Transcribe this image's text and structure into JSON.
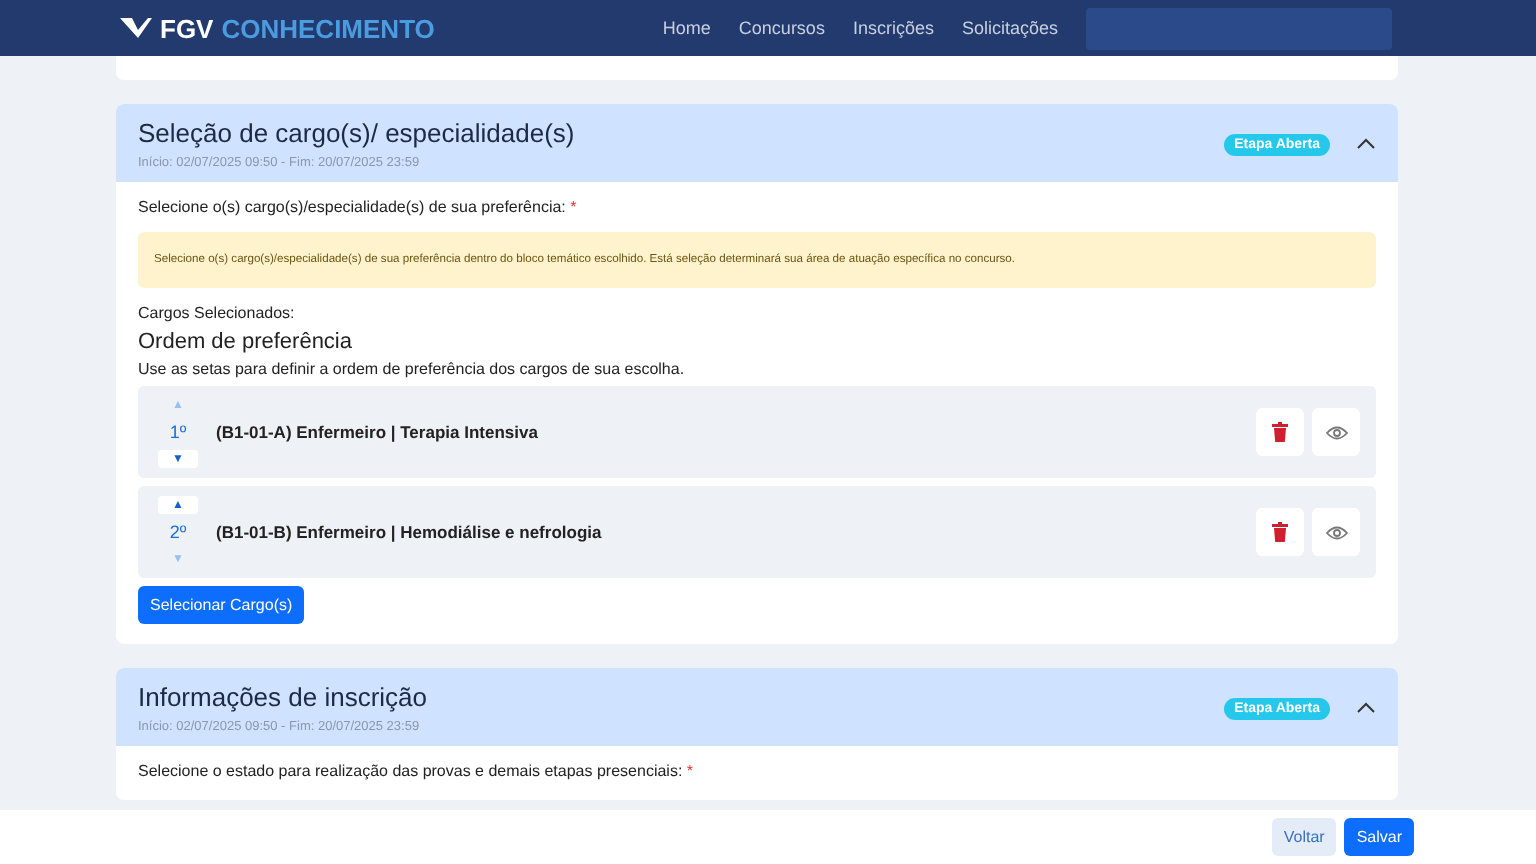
{
  "header": {
    "logo_mark": "FGV",
    "logo_text": "CONHECIMENTO",
    "nav": [
      "Home",
      "Concursos",
      "Inscrições",
      "Solicitações"
    ]
  },
  "sections": [
    {
      "title": "Seleção de cargo(s)/ especialidade(s)",
      "dates": "Início: 02/07/2025 09:50 - Fim: 20/07/2025 23:59",
      "badge": "Etapa Aberta",
      "expanded": true,
      "field_label": "Selecione o(s) cargo(s)/especialidade(s) de sua preferência:",
      "required_mark": "*",
      "alert": "Selecione o(s) cargo(s)/especialidade(s) de sua preferência dentro do bloco temático escolhido. Está seleção determinará sua área de atuação específica no concurso.",
      "selected_label": "Cargos Selecionados:",
      "order_title": "Ordem de preferência",
      "order_hint": "Use as setas para definir a ordem de preferência dos cargos de sua escolha.",
      "items": [
        {
          "rank": "1º",
          "up": "▲",
          "down": "▼",
          "up_disabled": true,
          "down_disabled": false,
          "name": "(B1-01-A) Enfermeiro | Terapia Intensiva"
        },
        {
          "rank": "2º",
          "up": "▲",
          "down": "▼",
          "up_disabled": false,
          "down_disabled": true,
          "name": "(B1-01-B) Enfermeiro | Hemodiálise e nefrologia"
        }
      ],
      "button": "Selecionar Cargo(s)"
    },
    {
      "title": "Informações de inscrição",
      "dates": "Início: 02/07/2025 09:50 - Fim: 20/07/2025 23:59",
      "badge": "Etapa Aberta",
      "expanded": true,
      "field_label": "Selecione o estado para realização das provas e demais etapas presenciais:",
      "required_mark": "*"
    }
  ],
  "footer": {
    "buttons": [
      {
        "label": "Voltar",
        "kind": "secondary"
      },
      {
        "label": "Salvar",
        "kind": "primary"
      }
    ]
  }
}
